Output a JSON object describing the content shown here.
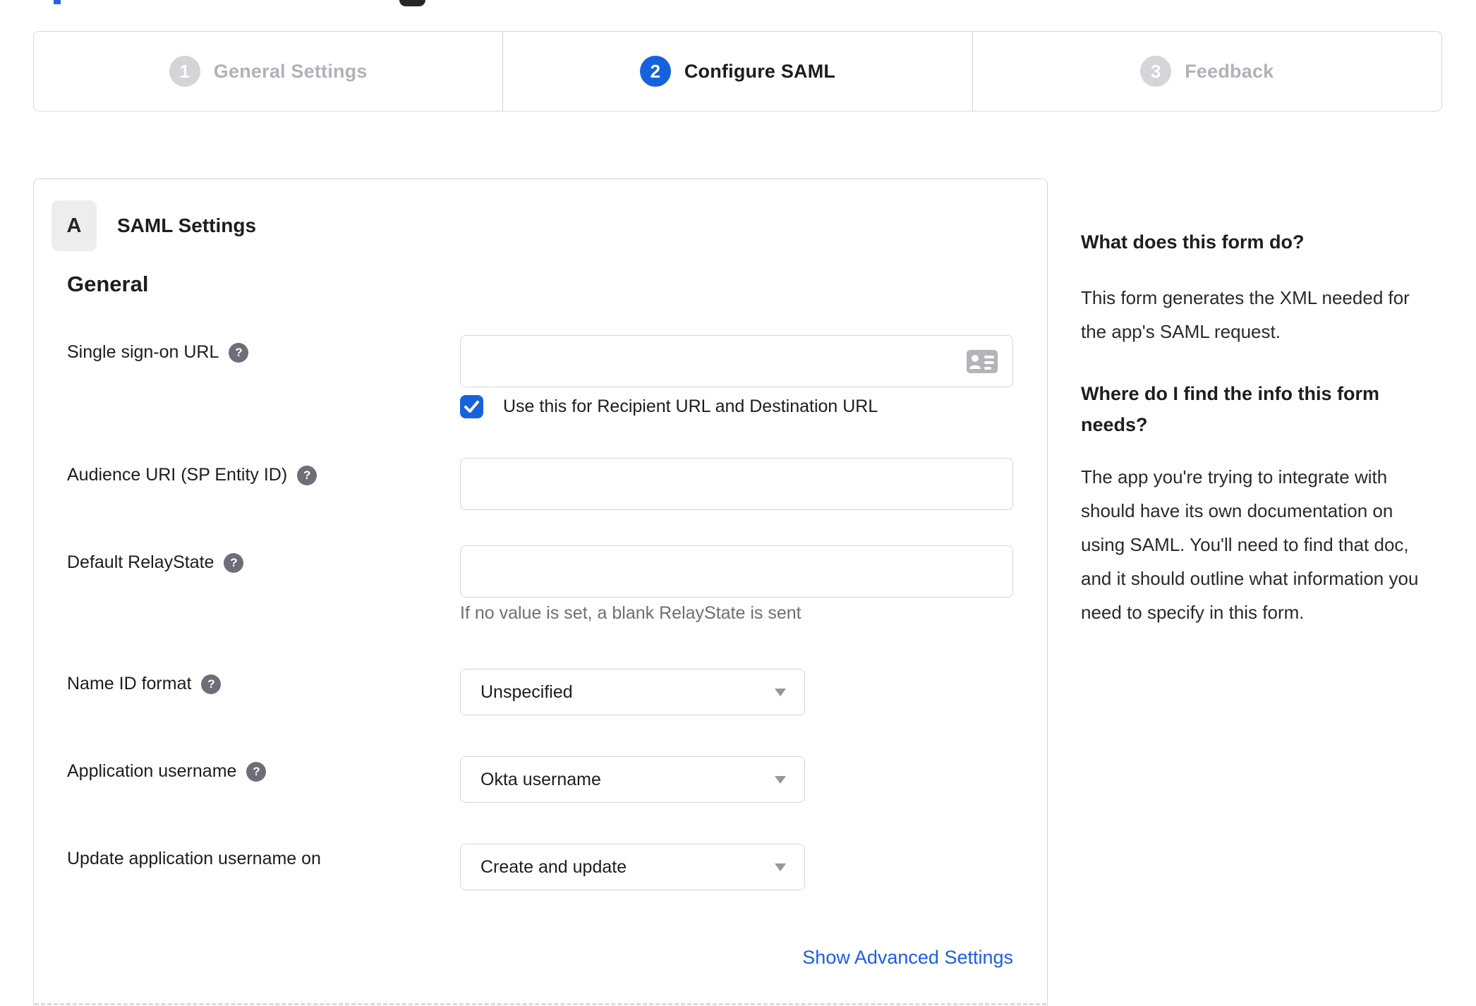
{
  "colors": {
    "accent": "#1662dd",
    "border": "#d7d7dc",
    "text": "#1d1d21",
    "muted": "#6e6e78",
    "inactive_label": "#b1b2b9",
    "link": "#1c5ded"
  },
  "icons": {
    "help": "?",
    "contact_card": "contact-card-icon",
    "dropdown_caret": "caret-down"
  },
  "stepper": {
    "steps": [
      {
        "number": "1",
        "label": "General Settings",
        "state": "inactive"
      },
      {
        "number": "2",
        "label": "Configure SAML",
        "state": "active"
      },
      {
        "number": "3",
        "label": "Feedback",
        "state": "inactive"
      }
    ]
  },
  "panel": {
    "badge": "A",
    "title": "SAML Settings",
    "section_heading": "General",
    "sso": {
      "label": "Single sign-on URL",
      "value": "",
      "checkbox_label": "Use this for Recipient URL and Destination URL",
      "checkbox_checked": true
    },
    "audience": {
      "label": "Audience URI (SP Entity ID)",
      "value": ""
    },
    "relay": {
      "label": "Default RelayState",
      "value": "",
      "hint": "If no value is set, a blank RelayState is sent"
    },
    "name_id": {
      "label": "Name ID format",
      "value": "Unspecified"
    },
    "app_username": {
      "label": "Application username",
      "value": "Okta username"
    },
    "update_username": {
      "label": "Update application username on",
      "value": "Create and update"
    },
    "advanced_link": "Show Advanced Settings"
  },
  "sidebar": {
    "heading1": "What does this form do?",
    "para1": "This form generates the XML needed for the app's SAML request.",
    "heading2": "Where do I find the info this form needs?",
    "para2": "The app you're trying to integrate with should have its own documentation on using SAML. You'll need to find that doc, and it should outline what information you need to specify in this form."
  }
}
